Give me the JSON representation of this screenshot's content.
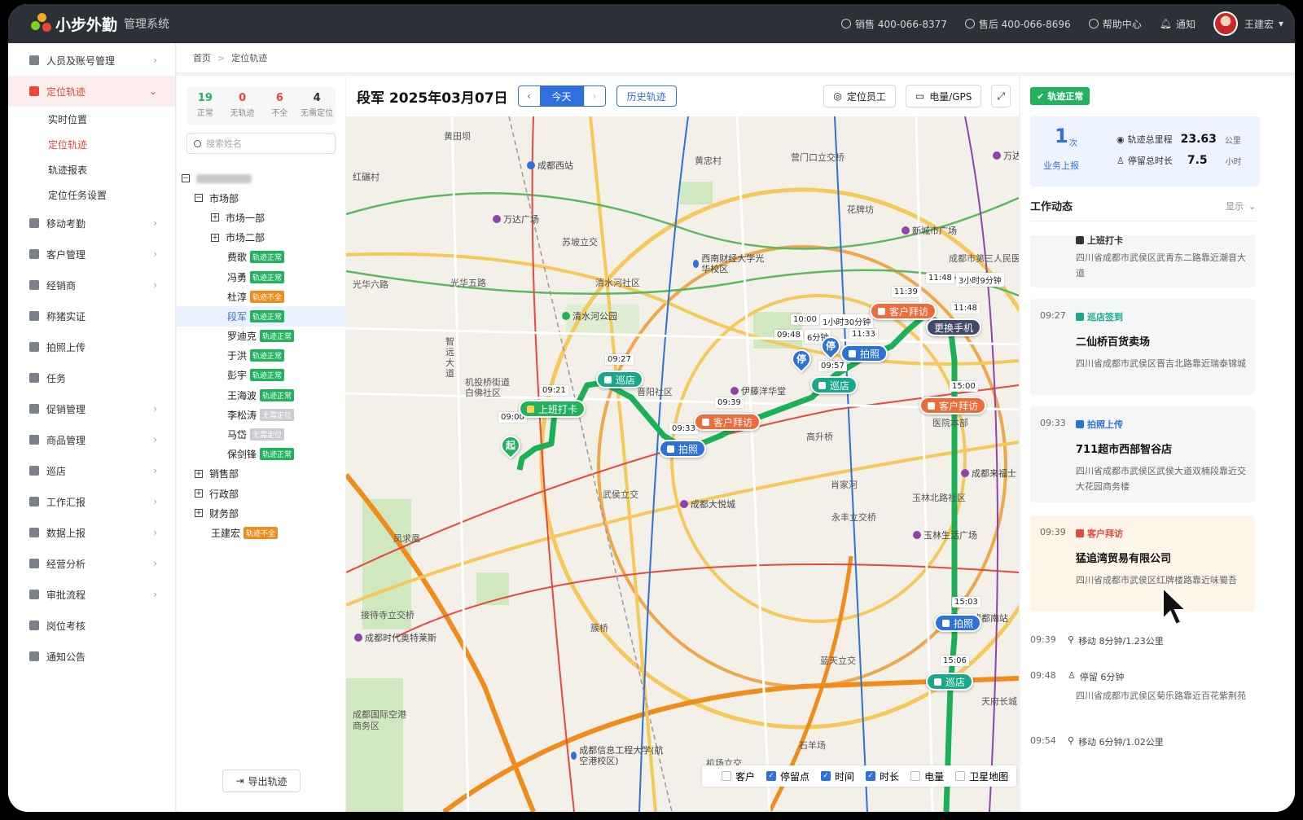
{
  "app": {
    "name": "小步外勤",
    "subtitle": "管理系统"
  },
  "topbar": {
    "sales": "销售 400-066-8377",
    "aftersales": "售后 400-066-8696",
    "help": "帮助中心",
    "notify": "通知",
    "user": "王建宏"
  },
  "menu": [
    {
      "label": "人员及账号管理"
    },
    {
      "label": "定位轨迹"
    },
    {
      "label": "移动考勤"
    },
    {
      "label": "客户管理"
    },
    {
      "label": "经销商"
    },
    {
      "label": "称猪实证"
    },
    {
      "label": "拍照上传"
    },
    {
      "label": "任务"
    },
    {
      "label": "促销管理"
    },
    {
      "label": "商品管理"
    },
    {
      "label": "巡店"
    },
    {
      "label": "工作汇报"
    },
    {
      "label": "数据上报"
    },
    {
      "label": "经营分析"
    },
    {
      "label": "审批流程"
    },
    {
      "label": "岗位考核"
    },
    {
      "label": "通知公告"
    }
  ],
  "submenu": [
    "实时位置",
    "定位轨迹",
    "轨迹报表",
    "定位任务设置"
  ],
  "breadcrumb": {
    "home": "首页",
    "current": "定位轨迹"
  },
  "stats": [
    {
      "num": "19",
      "label": "正常",
      "color": "#21b35c"
    },
    {
      "num": "0",
      "label": "无轨迹",
      "color": "#e8483a"
    },
    {
      "num": "6",
      "label": "不全",
      "color": "#e8483a"
    },
    {
      "num": "4",
      "label": "无需定位",
      "color": "#333333"
    }
  ],
  "search_placeholder": "搜索姓名",
  "tree": {
    "depts": [
      "市场部",
      "市场一部",
      "市场二部",
      "销售部",
      "行政部",
      "财务部"
    ],
    "people": [
      {
        "name": "费歌",
        "tag": "轨迹正常"
      },
      {
        "name": "冯勇",
        "tag": "轨迹正常"
      },
      {
        "name": "杜淳",
        "tag": "轨迹不全"
      },
      {
        "name": "段军",
        "tag": "轨迹正常"
      },
      {
        "name": "罗迪克",
        "tag": "轨迹正常"
      },
      {
        "name": "于洪",
        "tag": "轨迹正常"
      },
      {
        "name": "彭宇",
        "tag": "轨迹正常"
      },
      {
        "name": "王海波",
        "tag": "轨迹正常"
      },
      {
        "name": "李松涛",
        "tag": "无需定位"
      },
      {
        "name": "马岱",
        "tag": "无需定位"
      },
      {
        "name": "保剑锋",
        "tag": "轨迹正常"
      }
    ],
    "extra": {
      "name": "王建宏",
      "tag": "轨迹不全"
    }
  },
  "export_label": "导出轨迹",
  "map_header": {
    "title": "段军 2025年03月07日",
    "today": "今天",
    "history": "历史轨迹",
    "locate": "定位员工",
    "battery": "电量/GPS"
  },
  "map_labels": {
    "places": [
      "黄田坝",
      "红碾村",
      "苏坡立交",
      "光华六路",
      "光华五路",
      "清水河社区",
      "营门口立交桥",
      "花牌坊",
      "黄忠村",
      "机投桥街道白佛社区",
      "晋阳社区",
      "高升桥",
      "肖家河",
      "武侯立交",
      "玉林北路社区",
      "永丰立交桥",
      "接待寺立交桥",
      "簇桥",
      "蓝天立交",
      "石羊场",
      "天府长城",
      "机场立交",
      "成都国际空港商务区",
      "智远大道",
      "成都市第三人民医院",
      "医院本部",
      "凤求凰"
    ],
    "pois": [
      "成都西站",
      "万达广场",
      "西南财经大学光华校区",
      "清水河公园",
      "新城市广场",
      "伊藤洋华堂",
      "成都大悦城",
      "成都来福士",
      "玉林生活广场",
      "成都南站",
      "成都时代奥特莱斯",
      "成都信息工程大学(航空港校区)",
      "万达"
    ]
  },
  "track_times": [
    "09:00",
    "09:21",
    "09:27",
    "09:33",
    "09:39",
    "09:48",
    "6分钟",
    "10:00",
    "1小时30分钟",
    "11:33",
    "09:57",
    "11:39",
    "11:48",
    "3小时9分钟",
    "11:48",
    "15:00",
    "15:03",
    "15:06"
  ],
  "track_markers": {
    "start": "起",
    "clockin": "上班打卡",
    "patrol": "巡店",
    "photo": "拍照",
    "visit": "客户拜访",
    "stop": "停",
    "change": "更换手机"
  },
  "legend": [
    {
      "label": "客户",
      "checked": false
    },
    {
      "label": "停留点",
      "checked": true
    },
    {
      "label": "时间",
      "checked": true
    },
    {
      "label": "时长",
      "checked": true
    },
    {
      "label": "电量",
      "checked": false
    },
    {
      "label": "卫星地图",
      "checked": false
    }
  ],
  "right": {
    "badge": "轨迹正常",
    "report_count": "1",
    "report_unit": "次",
    "report_label": "业务上报",
    "distance_label": "轨迹总里程",
    "distance": "23.63",
    "distance_unit": "公里",
    "stay_label": "停留总时长",
    "stay": "7.5",
    "stay_unit": "小时",
    "work_title": "工作动态",
    "show": "显示",
    "top_partial": {
      "type": "上班打卡",
      "addr": "四川省成都市武侯区武青东二路靠近潮音大道"
    },
    "cards": [
      {
        "time": "09:27",
        "type": "巡店签到",
        "name": "二仙桥百货卖场",
        "addr": "四川省成都市武侯区晋吉北路靠近瑞泰锦城"
      },
      {
        "time": "09:33",
        "type": "拍照上传",
        "name": "711超市西部智谷店",
        "addr": "四川省成都市武侯区武侯大道双楠段靠近交大花园商务楼"
      },
      {
        "time": "09:39",
        "type": "客户拜访",
        "name": "猛追湾贸易有限公司",
        "addr": "四川省成都市武侯区红牌楼路靠近味蜀吾"
      }
    ],
    "rows": [
      {
        "time": "09:39",
        "text": "移动  8分钟/1.23公里"
      },
      {
        "time": "09:48",
        "text": "停留  6分钟",
        "addr": "四川省成都市武侯区菊乐路靠近百花紫荆苑"
      },
      {
        "time": "09:54",
        "text": "移动  6分钟/1.02公里"
      }
    ]
  }
}
